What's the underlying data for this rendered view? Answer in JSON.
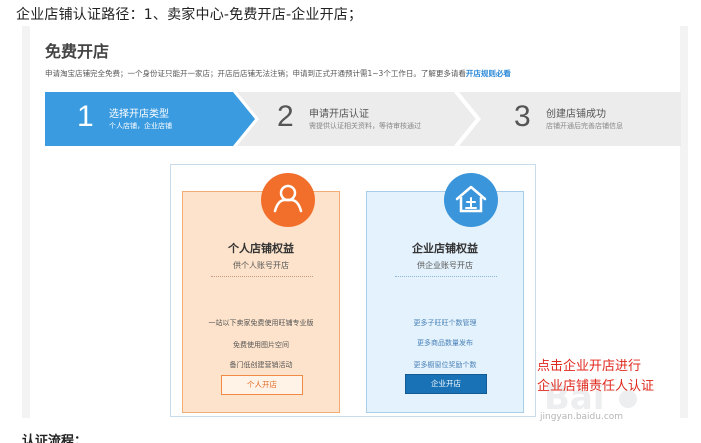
{
  "intro_text": "企业店铺认证路径：1、卖家中心-免费开店-企业开店；",
  "page_title": "免费开店",
  "notice": {
    "text": "申请淘宝店铺完全免费；一个身份证只能开一家店；开店后店铺无法注销；申请到正式开通预计需1~3个工作日。了解更多请看",
    "link": "开店规则必看"
  },
  "steps": [
    {
      "number": "1",
      "title": "选择开店类型",
      "desc": "个人店铺，企业店铺",
      "active": true
    },
    {
      "number": "2",
      "title": "申请开店认证",
      "desc": "需提供认证相关资料，等待审核通过",
      "active": false
    },
    {
      "number": "3",
      "title": "创建店铺成功",
      "desc": "店铺开通后完善店铺信息",
      "active": false
    }
  ],
  "personal_card": {
    "title": "个人店铺权益",
    "subtitle": "供个人账号开店",
    "features": [
      "一站以下卖家免费使用旺铺专业版",
      "免费使用图片空间",
      "备门低创建营销活动"
    ],
    "button": "个人开店"
  },
  "business_card": {
    "title": "企业店铺权益",
    "subtitle": "供企业账号开店",
    "features": [
      "更多子旺旺个数管理",
      "更多商品数量发布",
      "更多橱窗位奖励个数"
    ],
    "button": "企业开店"
  },
  "annotation": {
    "line1": "点击企业开店进行",
    "line2": "企业店铺责任人认证"
  },
  "watermark_text": "jingyan.baidu.com",
  "footer_text": "认证流程：",
  "colors": {
    "active_step": "#3a9be0",
    "inactive_step": "#ececec",
    "personal_accent": "#f26f2b",
    "business_accent": "#3a95db",
    "annotation": "#e0281d",
    "link": "#2e8bd8"
  },
  "icons": {
    "personal": "person-icon",
    "business": "shop-icon"
  }
}
